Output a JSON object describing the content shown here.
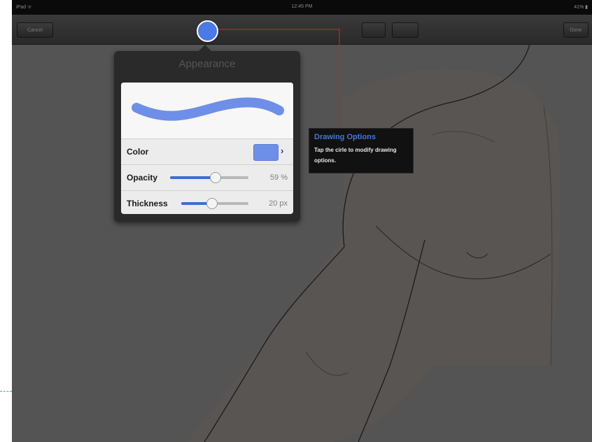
{
  "status_bar": {
    "carrier": "iPad ᯤ",
    "time": "12:45 PM",
    "battery": "41% ▮"
  },
  "toolbar": {
    "cancel_label": "Cancel",
    "done_label": "Done",
    "mid_button_1": "",
    "mid_button_2": ""
  },
  "drawing_options_button": {
    "color": "#4a79e8"
  },
  "appearance_popover": {
    "title": "Appearance",
    "color_label": "Color",
    "color_value": "#6e8fe8",
    "opacity_label": "Opacity",
    "opacity_value": "59 %",
    "opacity_fraction": 0.59,
    "thickness_label": "Thickness",
    "thickness_value": "20 px",
    "thickness_fraction": 0.45
  },
  "tooltip": {
    "title": "Drawing Options",
    "body": "Tap the cirle to modify drawing options."
  },
  "colors": {
    "accent": "#3f78dc",
    "connector": "#b52a2a",
    "canvas": "#545454"
  }
}
